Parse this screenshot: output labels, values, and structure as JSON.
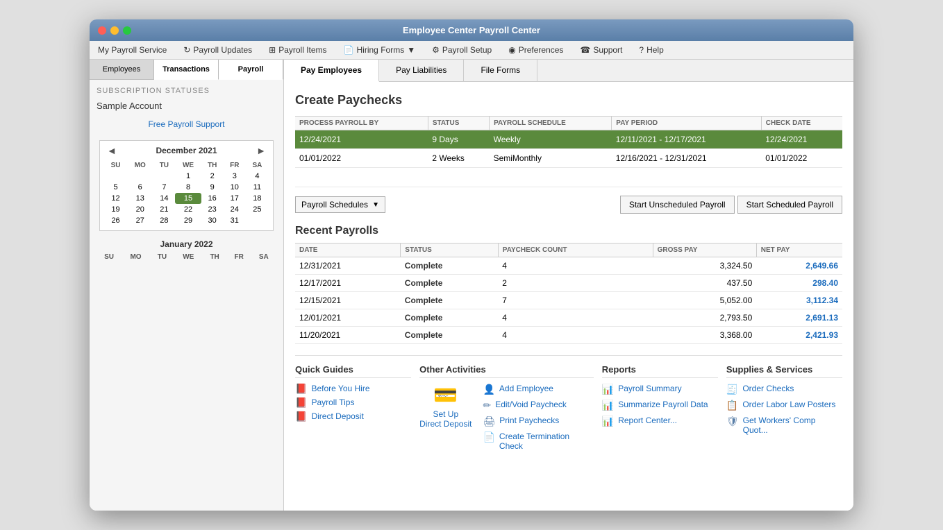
{
  "window": {
    "title": "Employee Center Payroll Center"
  },
  "menubar": {
    "service": "My Payroll Service",
    "items": [
      {
        "label": "Payroll Updates",
        "icon": "refresh"
      },
      {
        "label": "Payroll Items",
        "icon": "grid"
      },
      {
        "label": "Hiring Forms",
        "icon": "document",
        "dropdown": true
      },
      {
        "label": "Payroll Setup",
        "icon": "gear"
      },
      {
        "label": "Preferences",
        "icon": "radio"
      },
      {
        "label": "Support",
        "icon": "headset"
      },
      {
        "label": "Help",
        "icon": "question"
      }
    ]
  },
  "sidebar": {
    "tabs": [
      "Employees",
      "Transactions",
      "Payroll"
    ],
    "active_tab": "Payroll",
    "subscription_header": "SUBSCRIPTION STATUSES",
    "account_name": "Sample Account",
    "free_support": "Free Payroll Support"
  },
  "calendar": {
    "month1": {
      "title": "December 2021",
      "days_header": [
        "SU",
        "MO",
        "TU",
        "WE",
        "TH",
        "FR",
        "SA"
      ],
      "weeks": [
        [
          null,
          null,
          null,
          1,
          2,
          3,
          4
        ],
        [
          5,
          6,
          7,
          8,
          9,
          10,
          11
        ],
        [
          12,
          13,
          14,
          15,
          16,
          17,
          18
        ],
        [
          19,
          20,
          21,
          22,
          23,
          24,
          25
        ],
        [
          26,
          27,
          28,
          29,
          30,
          31,
          null
        ]
      ],
      "today": 15
    },
    "month2": {
      "title": "January 2022",
      "days_header": [
        "SU",
        "MO",
        "TU",
        "WE",
        "TH",
        "FR",
        "SA"
      ]
    }
  },
  "content": {
    "tabs": [
      "Pay Employees",
      "Pay Liabilities",
      "File Forms"
    ],
    "active_tab": "Pay Employees",
    "create_paychecks_title": "Create Paychecks",
    "table_headers": {
      "process_by": "PROCESS PAYROLL BY",
      "status": "STATUS",
      "payroll_schedule": "PAYROLL SCHEDULE",
      "pay_period": "PAY PERIOD",
      "check_date": "CHECK DATE"
    },
    "payroll_rows": [
      {
        "process_by": "12/24/2021",
        "status": "9 Days",
        "schedule": "Weekly",
        "pay_period": "12/11/2021 - 12/17/2021",
        "check_date": "12/24/2021",
        "highlighted": true
      },
      {
        "process_by": "01/01/2022",
        "status": "2 Weeks",
        "schedule": "SemiMonthly",
        "pay_period": "12/16/2021 - 12/31/2021",
        "check_date": "01/01/2022",
        "highlighted": false
      }
    ],
    "payroll_schedules_btn": "Payroll Schedules",
    "start_unscheduled": "Start Unscheduled Payroll",
    "start_scheduled": "Start Scheduled Payroll",
    "recent_payrolls_title": "Recent Payrolls",
    "recent_headers": {
      "date": "DATE",
      "status": "STATUS",
      "paycheck_count": "PAYCHECK COUNT",
      "gross_pay": "GROSS PAY",
      "net_pay": "NET PAY"
    },
    "recent_rows": [
      {
        "date": "12/31/2021",
        "status": "Complete",
        "count": "4",
        "gross": "3,324.50",
        "net": "2,649.66"
      },
      {
        "date": "12/17/2021",
        "status": "Complete",
        "count": "2",
        "gross": "437.50",
        "net": "298.40"
      },
      {
        "date": "12/15/2021",
        "status": "Complete",
        "count": "7",
        "gross": "5,052.00",
        "net": "3,112.34"
      },
      {
        "date": "12/01/2021",
        "status": "Complete",
        "count": "4",
        "gross": "2,793.50",
        "net": "2,691.13"
      },
      {
        "date": "11/20/2021",
        "status": "Complete",
        "count": "4",
        "gross": "3,368.00",
        "net": "2,421.93"
      }
    ]
  },
  "panels": {
    "quick_guides": {
      "title": "Quick Guides",
      "items": [
        "Before  You  Hire",
        "Payroll  Tips",
        "Direct  Deposit"
      ]
    },
    "other_activities": {
      "title": "Other Activities",
      "center_icon": "💳",
      "center_label1": "Set Up",
      "center_label2": "Direct Deposit",
      "right_items": [
        "Add Employee",
        "Edit/Void Paycheck",
        "Print Paychecks",
        "Create Termination Check"
      ]
    },
    "reports": {
      "title": "Reports",
      "items": [
        "Payroll Summary",
        "Summarize Payroll Data",
        "Report Center..."
      ]
    },
    "supplies": {
      "title": "Supplies & Services",
      "items": [
        "Order Checks",
        "Order Labor Law Posters",
        "Get Workers' Comp Quot..."
      ]
    }
  }
}
